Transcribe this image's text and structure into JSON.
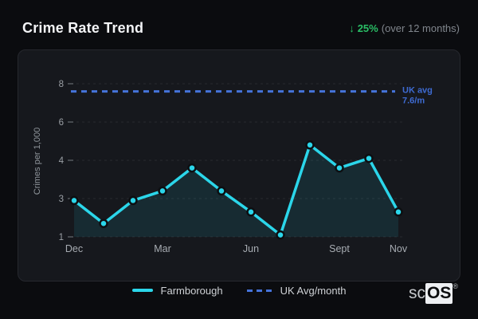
{
  "header": {
    "title": "Crime Rate Trend",
    "stat": {
      "arrow": "↓",
      "percent": "25%",
      "caption": "(over 12 months)",
      "color": "#2abf66"
    }
  },
  "chart_data": {
    "type": "line",
    "title": "Crime Rate Trend",
    "ylabel": "Crimes per 1,000",
    "y_ticks": [
      1,
      3,
      4,
      6,
      8
    ],
    "y_axis_note": "tick labels rendered at even spacing (non-linear value scale)",
    "x_tick_labels": [
      "Dec",
      "Mar",
      "Jun",
      "Sept",
      "Nov"
    ],
    "x_tick_point_indices": [
      0,
      3,
      6,
      9,
      11
    ],
    "grid": "horizontal-dashed",
    "legend_position": "bottom",
    "series": [
      {
        "name": "Farmborough",
        "type": "line-area",
        "color": "#2bd6ea",
        "area_fill_alpha": 0.1,
        "values": [
          2.9,
          1.7,
          2.9,
          3.2,
          3.8,
          3.2,
          2.3,
          1.1,
          4.8,
          3.8,
          4.1,
          2.3
        ]
      },
      {
        "name": "UK Avg/month",
        "type": "reference-line",
        "color": "#4573da",
        "value": 7.6,
        "label_lines": [
          "UK avg",
          "7.6/m"
        ],
        "label_color": "#3e6bd2"
      }
    ]
  },
  "logo": {
    "prefix": "sc",
    "os": "OS",
    "reg": "®"
  }
}
